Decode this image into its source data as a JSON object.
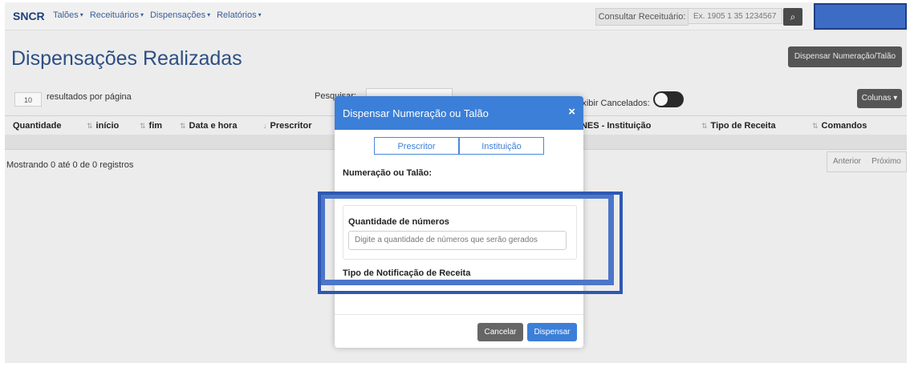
{
  "navbar": {
    "brand": "SNCR",
    "menu": [
      "Talões",
      "Receituários",
      "Dispensações",
      "Relatórios"
    ],
    "consult_label": "Consultar Receituário:",
    "consult_placeholder": "Ex. 1905 1 35 1234567",
    "search_icon": "search-icon"
  },
  "page": {
    "title": "Dispensações Realizadas",
    "top_button": "Dispensar Numeração/Talão",
    "per_page_value": "10",
    "per_page_label": "resultados por página",
    "search_label": "Pesquisar:",
    "show_cancelled_label": "Exibir Cancelados:",
    "columns_button": "Colunas"
  },
  "table": {
    "headers": [
      "Quantidade",
      "início",
      "fim",
      "Data e hora",
      "Prescritor",
      "CNES - Instituição",
      "Tipo de Receita",
      "Comandos"
    ]
  },
  "footer": {
    "records": "Mostrando 0 até 0 de 0 registros",
    "prev": "Anterior",
    "next": "Próximo"
  },
  "modal": {
    "title": "Dispensar Numeração ou Talão",
    "close": "×",
    "segments": [
      "Prescritor",
      "Instituição"
    ],
    "numeracao_label": "Numeração ou Talão:",
    "quantidade_label": "Quantidade de números",
    "quantidade_placeholder": "Digite a quantidade de números que serão gerados",
    "tipo_label": "Tipo de Notificação de Receita",
    "cancel": "Cancelar",
    "dispense": "Dispensar"
  },
  "colors": {
    "brand": "#1f3f7a",
    "modal_header": "#3b7fd8",
    "highlight": "#2e58b2"
  }
}
